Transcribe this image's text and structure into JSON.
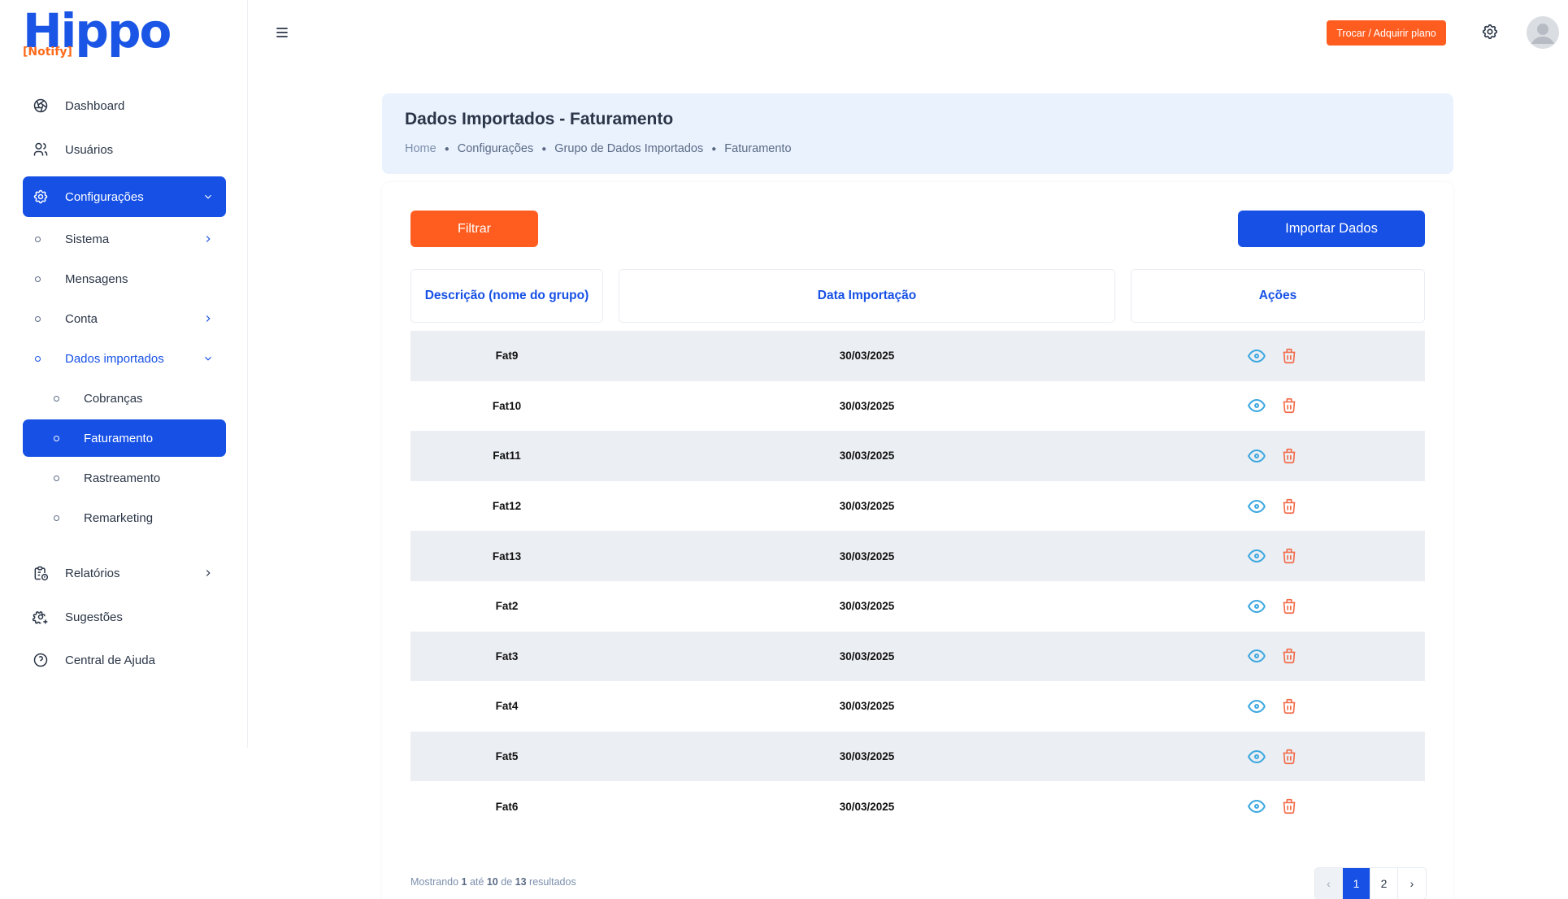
{
  "brand": {
    "name": "Hippo",
    "sub": "[Notify]"
  },
  "sidebar": {
    "items": [
      {
        "label": "Dashboard",
        "icon": "aperture-icon"
      },
      {
        "label": "Usuários",
        "icon": "users-icon"
      },
      {
        "label": "Configurações",
        "icon": "settings-icon"
      }
    ],
    "config_sub": [
      {
        "label": "Sistema"
      },
      {
        "label": "Mensagens"
      },
      {
        "label": "Conta"
      },
      {
        "label": "Dados importados"
      }
    ],
    "dados_sub": [
      {
        "label": "Cobranças"
      },
      {
        "label": "Faturamento"
      },
      {
        "label": "Rastreamento"
      },
      {
        "label": "Remarketing"
      }
    ],
    "bottom_items": [
      {
        "label": "Relatórios",
        "icon": "report-icon"
      },
      {
        "label": "Sugestões",
        "icon": "settings-plus-icon"
      },
      {
        "label": "Central de Ajuda",
        "icon": "help-circle-icon"
      }
    ]
  },
  "header": {
    "plan_button": "Trocar / Adquirir plano"
  },
  "page": {
    "title": "Dados Importados - Faturamento",
    "breadcrumb": [
      "Home",
      "Configurações",
      "Grupo de Dados Importados",
      "Faturamento"
    ]
  },
  "toolbar": {
    "filter_label": "Filtrar",
    "import_label": "Importar Dados"
  },
  "table": {
    "headers": [
      "Descrição (nome do grupo)",
      "Data Importação",
      "Ações"
    ],
    "rows": [
      {
        "desc": "Fat9",
        "date": "30/03/2025"
      },
      {
        "desc": "Fat10",
        "date": "30/03/2025"
      },
      {
        "desc": "Fat11",
        "date": "30/03/2025"
      },
      {
        "desc": "Fat12",
        "date": "30/03/2025"
      },
      {
        "desc": "Fat13",
        "date": "30/03/2025"
      },
      {
        "desc": "Fat2",
        "date": "30/03/2025"
      },
      {
        "desc": "Fat3",
        "date": "30/03/2025"
      },
      {
        "desc": "Fat4",
        "date": "30/03/2025"
      },
      {
        "desc": "Fat5",
        "date": "30/03/2025"
      },
      {
        "desc": "Fat6",
        "date": "30/03/2025"
      }
    ]
  },
  "footer": {
    "showing_prefix": "Mostrando",
    "from": "1",
    "to_word": "até",
    "to": "10",
    "of_word": "de",
    "total": "13",
    "suffix": "resultados"
  },
  "pagination": {
    "prev": "‹",
    "pages": [
      "1",
      "2"
    ],
    "current": "1",
    "next": "›"
  },
  "colors": {
    "primary": "#1650e5",
    "accent": "#ff5d1f",
    "eye": "#3da8e0",
    "trash": "#f26b4a",
    "row_alt": "#ebeef2"
  }
}
